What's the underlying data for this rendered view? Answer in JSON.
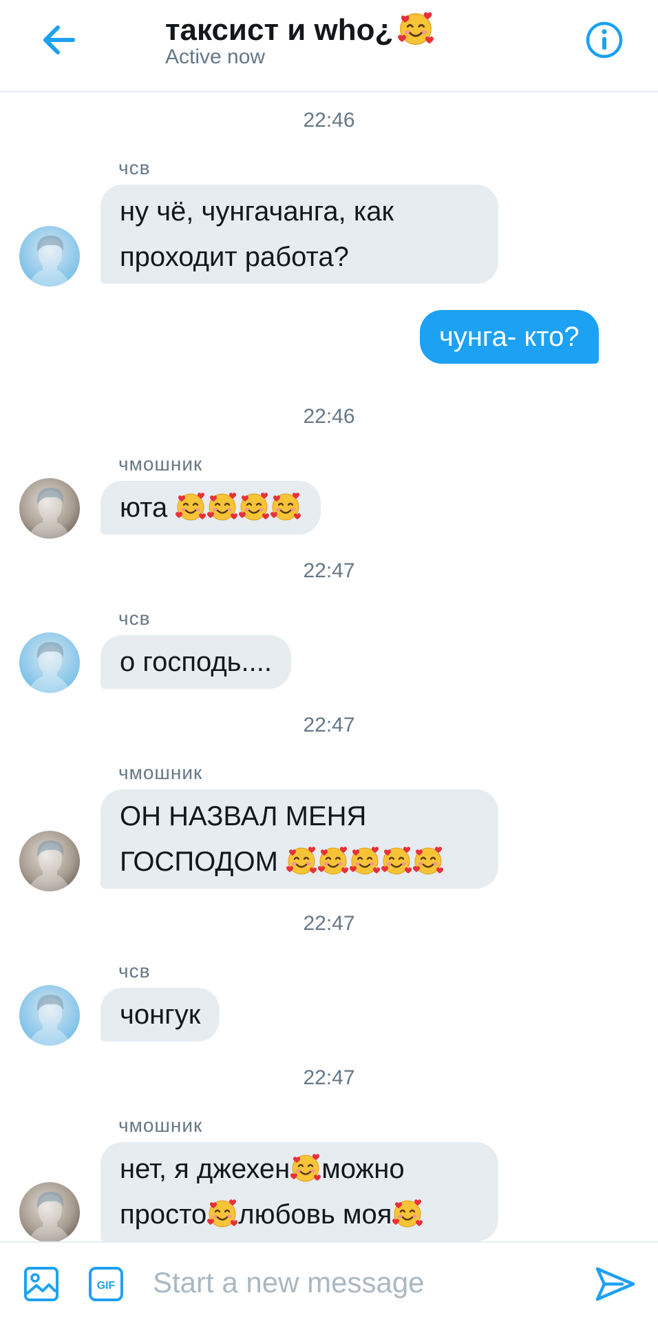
{
  "header": {
    "title": "таксист и who¿",
    "subtitle": "Active now",
    "accent_color": "#1da1f2"
  },
  "messages": [
    {
      "timestamp": "22:46"
    },
    {
      "sender": "чсв",
      "lines": [
        "ну чё, чунгачанга, как",
        "проходит работа?"
      ]
    },
    {
      "outgoing": true,
      "text": "чунга- кто?"
    },
    {
      "timestamp": "22:46"
    },
    {
      "sender": "чмошник",
      "text": "юта",
      "emoji_count": 4
    },
    {
      "timestamp": "22:47"
    },
    {
      "sender": "чсв",
      "text": "о господь...."
    },
    {
      "timestamp": "22:47"
    },
    {
      "sender": "чмошник",
      "lines": [
        "ОН НАЗВАЛ МЕНЯ",
        "ГОСПОДОМ"
      ],
      "emoji_count": 5
    },
    {
      "timestamp": "22:47"
    },
    {
      "sender": "чсв",
      "text": "чонгук"
    },
    {
      "timestamp": "22:47"
    },
    {
      "sender": "чмошник",
      "lines": [
        "нет, я джехен",
        "можно",
        "просто",
        "любовь моя"
      ]
    }
  ],
  "composer": {
    "placeholder": "Start a new message",
    "gif_label": "GIF"
  },
  "icons": [
    "back-arrow-icon",
    "info-icon",
    "smiling-face-with-hearts-emoji",
    "image-icon",
    "gif-icon",
    "send-icon"
  ]
}
